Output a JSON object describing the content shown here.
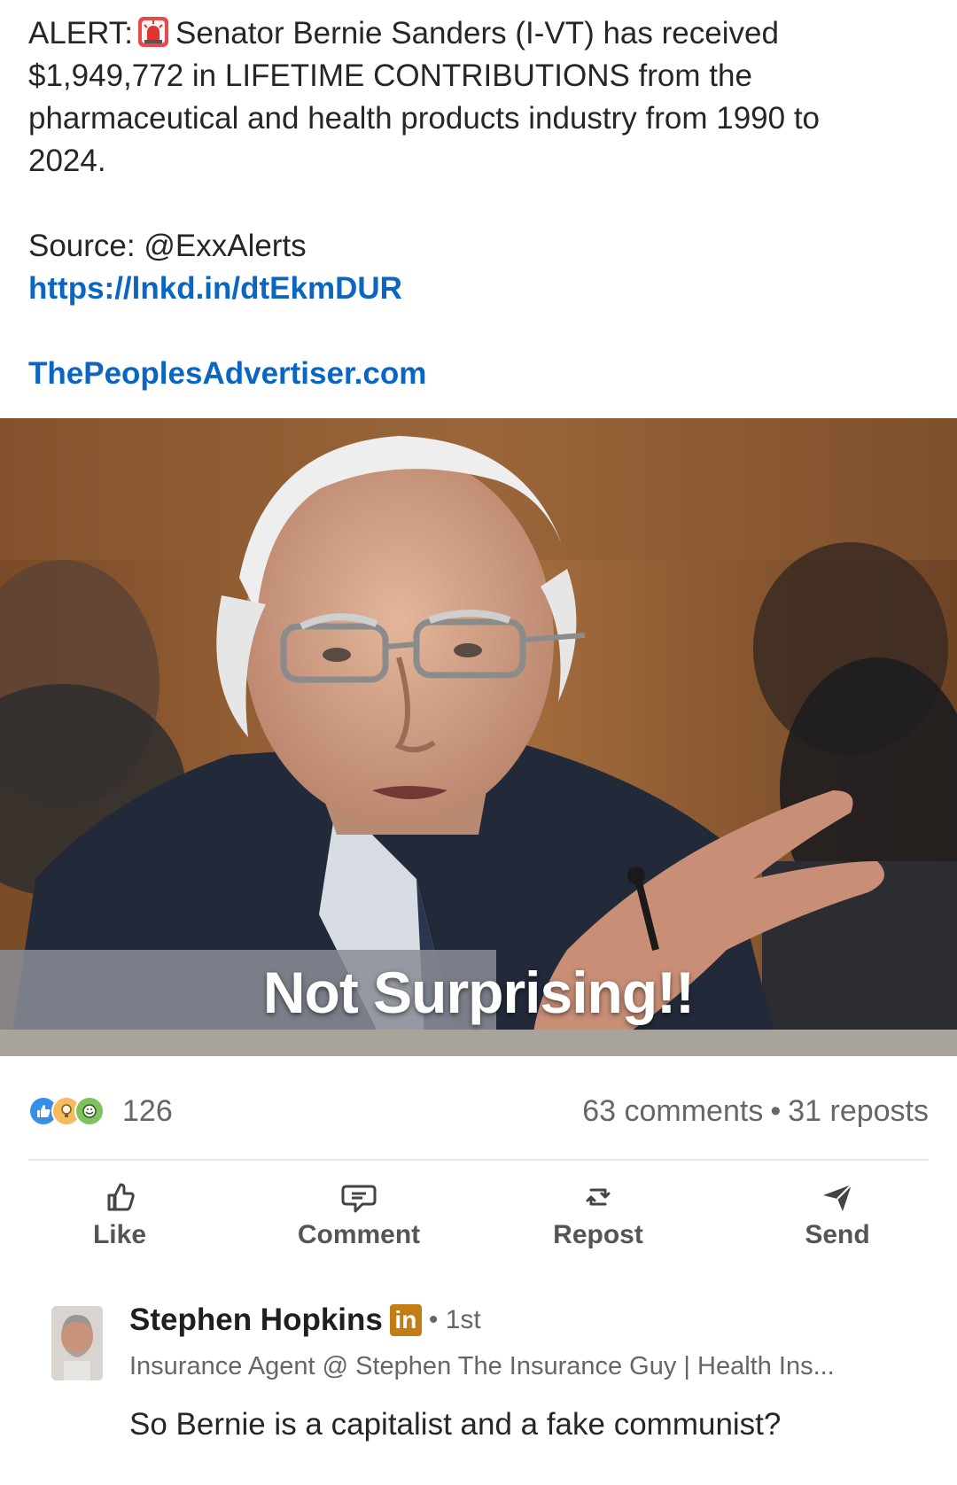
{
  "post": {
    "alert_prefix": "ALERT:",
    "alert_body_line1": "Senator Bernie Sanders (I-VT) has received",
    "alert_body_line2": "$1,949,772 in LIFETIME CONTRIBUTIONS from the",
    "alert_body_line3": "pharmaceutical and health products industry from 1990 to",
    "alert_body_line4": "2024.",
    "source_label": "Source: @ExxAlerts",
    "link_1": "https://lnkd.in/dtEkmDUR",
    "link_2": "ThePeoplesAdvertiser.com",
    "icons": {
      "alert": "siren-icon"
    }
  },
  "image": {
    "caption": "Not Surprising!!"
  },
  "social": {
    "reaction_count": "126",
    "comments": "63 comments",
    "separator": "•",
    "reposts": "31 reposts",
    "reaction_icons": [
      "like-icon",
      "insightful-icon",
      "funny-icon"
    ]
  },
  "actions": [
    {
      "label": "Like",
      "icon": "thumbs-up-icon"
    },
    {
      "label": "Comment",
      "icon": "comment-icon"
    },
    {
      "label": "Repost",
      "icon": "repost-icon"
    },
    {
      "label": "Send",
      "icon": "send-icon"
    }
  ],
  "comment": {
    "author": "Stephen Hopkins",
    "badge": "in",
    "degree": "• 1st",
    "headline": "Insurance Agent @ Stephen The Insurance Guy | Health Ins...",
    "text": "So Bernie is a capitalist and a fake communist?"
  },
  "colors": {
    "link": "#0a66c2",
    "muted_text": "#666666",
    "linkedin_badge": "#c37d16"
  }
}
